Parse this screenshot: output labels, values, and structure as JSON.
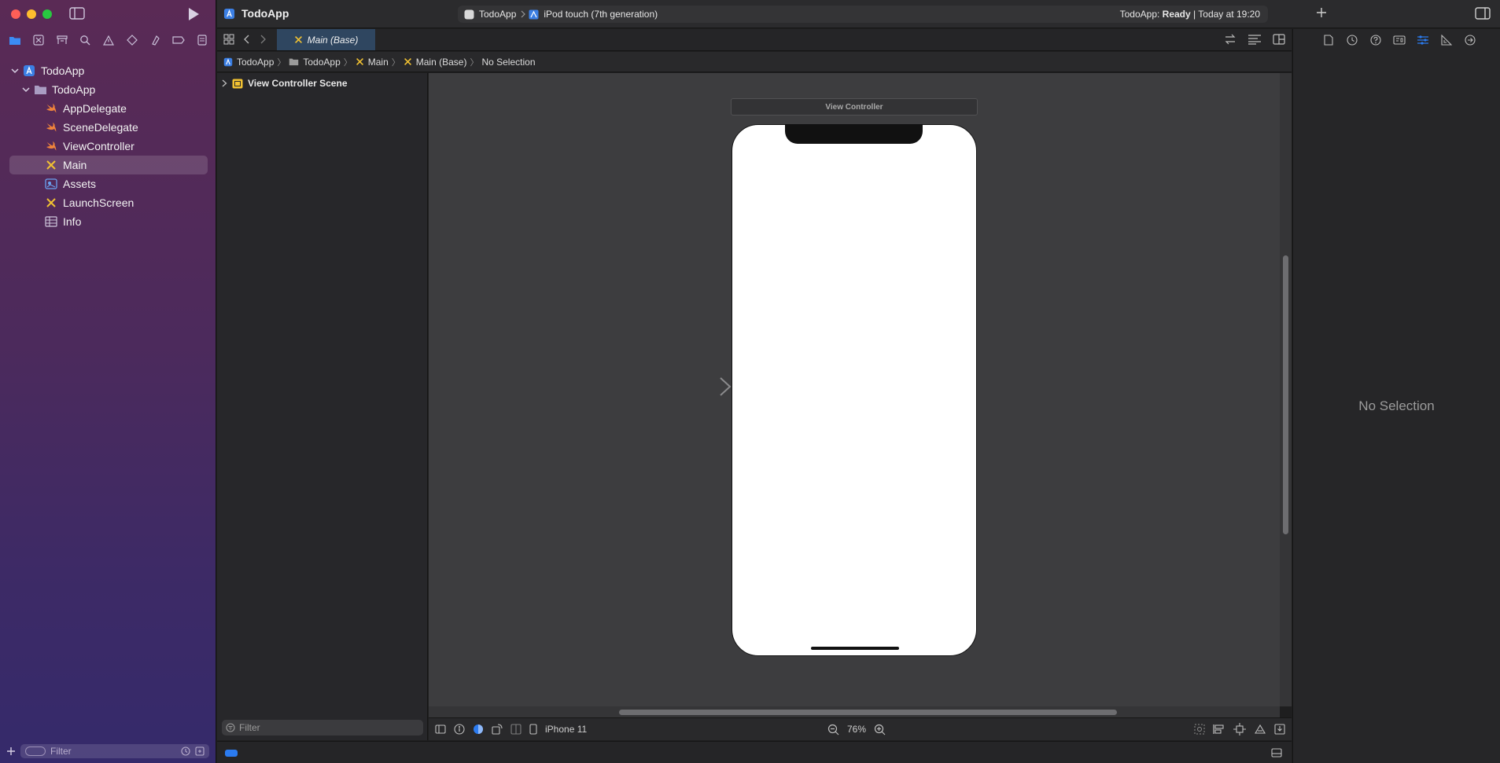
{
  "window": {
    "project_title": "TodoApp"
  },
  "scheme": {
    "target": "TodoApp",
    "destination": "iPod touch (7th generation)",
    "status_prefix": "TodoApp: ",
    "status_state": "Ready",
    "status_suffix": " | Today at 19:20"
  },
  "navigator": {
    "tree": [
      {
        "label": "TodoApp",
        "icon": "project-icon",
        "level": 0
      },
      {
        "label": "TodoApp",
        "icon": "folder-icon",
        "level": 1
      },
      {
        "label": "AppDelegate",
        "icon": "swift-file-icon",
        "level": 2
      },
      {
        "label": "SceneDelegate",
        "icon": "swift-file-icon",
        "level": 2
      },
      {
        "label": "ViewController",
        "icon": "swift-file-icon",
        "level": 2
      },
      {
        "label": "Main",
        "icon": "storyboard-icon",
        "level": 2,
        "selected": true
      },
      {
        "label": "Assets",
        "icon": "asset-catalog-icon",
        "level": 2
      },
      {
        "label": "LaunchScreen",
        "icon": "storyboard-icon",
        "level": 2
      },
      {
        "label": "Info",
        "icon": "plist-icon",
        "level": 2
      }
    ],
    "filter_placeholder": "Filter"
  },
  "editor": {
    "active_tab": "Main (Base)",
    "breadcrumb": [
      "TodoApp",
      "TodoApp",
      "Main",
      "Main (Base)",
      "No Selection"
    ],
    "outline_scene": "View Controller Scene",
    "outline_filter_placeholder": "Filter",
    "scene_title": "View Controller",
    "device": "iPhone 11",
    "zoom": "76%"
  },
  "inspector": {
    "empty_text": "No Selection"
  },
  "colors": {
    "accent": "#2b7bf0",
    "swift": "#f0843c",
    "storyboard": "#f2c232",
    "sidebar_top": "#5a2a55",
    "sidebar_bottom": "#352a6b"
  }
}
